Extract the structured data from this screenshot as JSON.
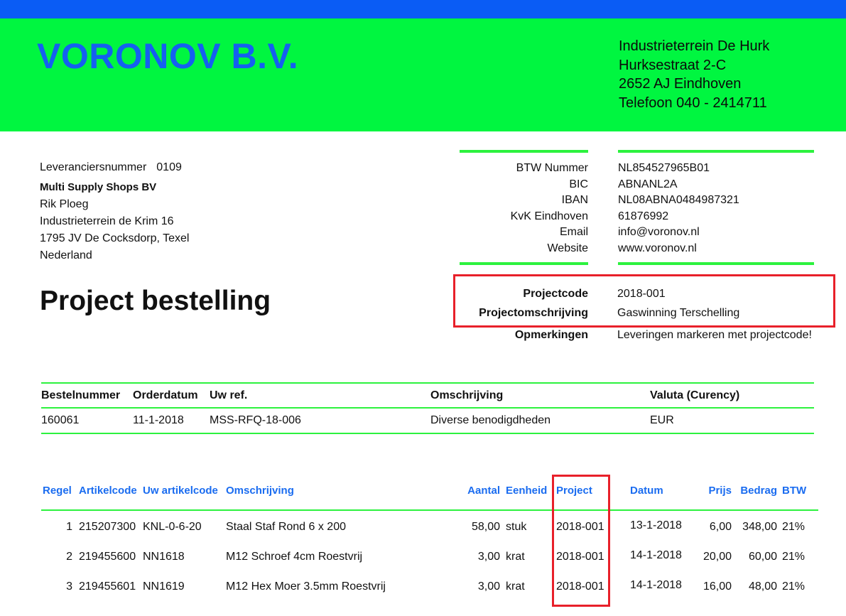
{
  "company": {
    "name": "VORONOV B.V.",
    "address": [
      "Industrieterrein De Hurk",
      "Hurksestraat 2-C",
      "2652 AJ  Eindhoven",
      "Telefoon 040 - 2414711"
    ]
  },
  "supplier": {
    "number_label": "Leveranciersnummer",
    "number_value": "0109",
    "name": "Multi Supply Shops BV",
    "contact": "Rik Ploeg",
    "street": "Industrieterrein de Krim 16",
    "city": "1795 JV  De Cocksdorp, Texel",
    "country": "Nederland"
  },
  "document_title": "Project bestelling",
  "company_info": [
    {
      "label": "BTW Nummer",
      "value": "NL854527965B01"
    },
    {
      "label": "BIC",
      "value": "ABNANL2A"
    },
    {
      "label": "IBAN",
      "value": "NL08ABNA0484987321"
    },
    {
      "label": "KvK Eindhoven",
      "value": "61876992"
    },
    {
      "label": "Email",
      "value": "info@voronov.nl"
    },
    {
      "label": "Website",
      "value": "www.voronov.nl"
    }
  ],
  "project": {
    "code_label": "Projectcode",
    "code_value": "2018-001",
    "description_label": "Projectomschrijving",
    "description_value": "Gaswinning Terschelling",
    "remarks_label": "Opmerkingen",
    "remarks_value": "Leveringen markeren met projectcode!"
  },
  "order": {
    "headers": [
      "Bestelnummer",
      "Orderdatum",
      "Uw ref.",
      "Omschrijving",
      "Valuta (Curency)"
    ],
    "row": [
      "160061",
      "11-1-2018",
      "MSS-RFQ-18-006",
      "Diverse benodigdheden",
      "EUR"
    ]
  },
  "lines": {
    "headers": [
      "Regel",
      "Artikelcode",
      "Uw artikelcode",
      "Omschrijving",
      "Aantal",
      "Eenheid",
      "Project",
      "Datum",
      "Prijs",
      "Bedrag",
      "BTW"
    ],
    "rows": [
      [
        "1",
        "215207300",
        "KNL-0-6-20",
        "Staal Staf Rond 6 x 200",
        "58,00",
        "stuk",
        "2018-001",
        "13-1-2018",
        "6,00",
        "348,00",
        "21%"
      ],
      [
        "2",
        "219455600",
        "NN1618",
        "M12 Schroef 4cm Roestvrij",
        "3,00",
        "krat",
        "2018-001",
        "14-1-2018",
        "20,00",
        "60,00",
        "21%"
      ],
      [
        "3",
        "219455601",
        "NN1619",
        "M12 Hex Moer 3.5mm Roestvrij",
        "3,00",
        "krat",
        "2018-001",
        "14-1-2018",
        "16,00",
        "48,00",
        "21%"
      ]
    ]
  },
  "colors": {
    "top_bar": "#0a5cf5",
    "header_bg": "#00f640",
    "company_name": "#1560f0",
    "accent_line": "#2cf23e",
    "line_headers": "#1a6cf0",
    "highlight_box": "#e8202a"
  }
}
